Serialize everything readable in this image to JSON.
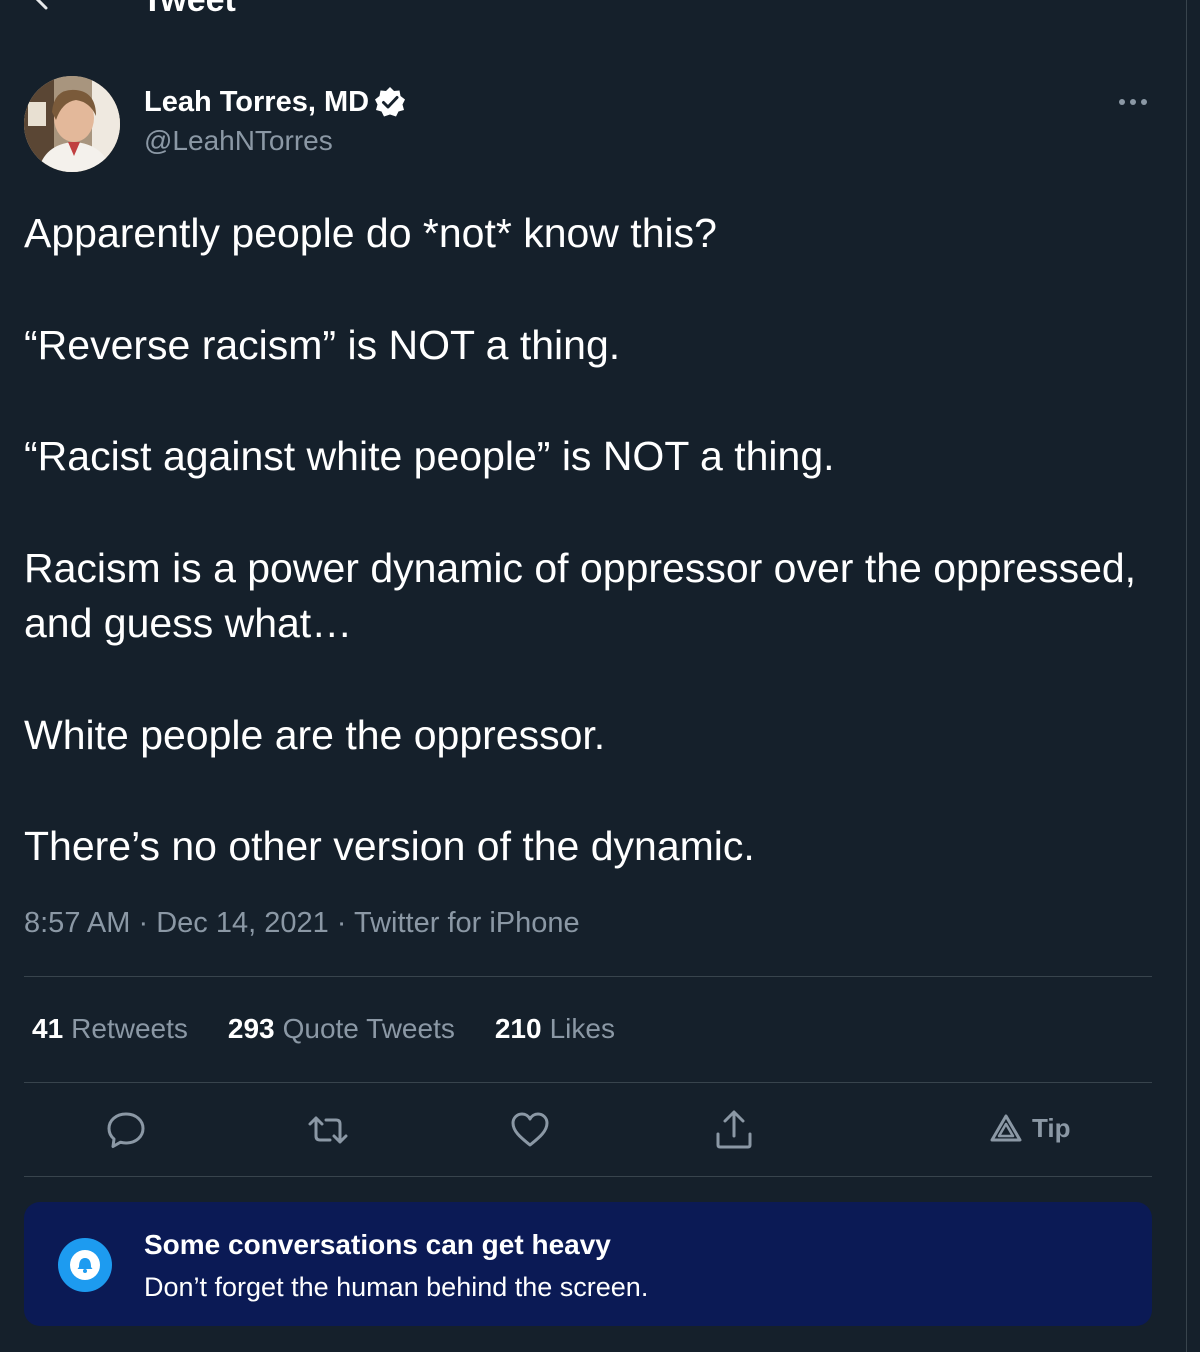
{
  "header": {
    "title": "Tweet"
  },
  "tweet": {
    "author": {
      "name": "Leah Torres, MD",
      "handle": "@LeahNTorres",
      "verified": true
    },
    "body": [
      "Apparently people do *not* know this?",
      "“Reverse racism” is NOT a thing.",
      "“Racist against white people” is NOT a thing.",
      "Racism is a power dynamic of oppressor over the oppressed, and guess what…",
      "White people are the oppressor.",
      "There’s no other version of the dynamic."
    ],
    "time": "8:57 AM",
    "date": "Dec 14, 2021",
    "source": "Twitter for iPhone",
    "separator": "·",
    "stats": {
      "retweets": {
        "count": "41",
        "label": "Retweets"
      },
      "quote_tweets": {
        "count": "293",
        "label": "Quote Tweets"
      },
      "likes": {
        "count": "210",
        "label": "Likes"
      }
    },
    "actions": {
      "tip_label": "Tip"
    }
  },
  "banner": {
    "title": "Some conversations can get heavy",
    "text": "Don’t forget the human behind the screen."
  },
  "icons": [
    "back-arrow-icon",
    "verified-badge-icon",
    "more-icon",
    "reply-icon",
    "retweet-icon",
    "like-icon",
    "share-icon",
    "tip-icon",
    "bell-icon"
  ],
  "colors": {
    "background": "#15202b",
    "text": "#e7e9ea",
    "muted": "#8b98a5",
    "border": "#38444d",
    "accent": "#1d9bf0",
    "banner": "#0b1a55"
  }
}
